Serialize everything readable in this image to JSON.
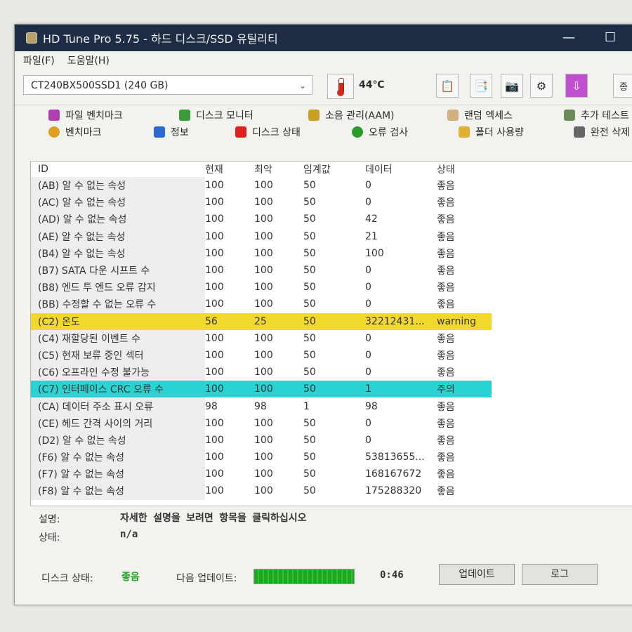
{
  "window": {
    "title": "HD Tune Pro 5.75 - 하드 디스크/SSD 유틸리티",
    "minimize": "—",
    "maximize": "☐"
  },
  "menu": [
    "파일(F)",
    "도움말(H)"
  ],
  "drive": {
    "name": "CT240BX500SSD1 (240 GB)",
    "temperature": "44℃"
  },
  "toolbar": {
    "partial_label": "종"
  },
  "tabs_row1": [
    {
      "label": "파일 벤치마크",
      "icon": "file-benchmark-icon",
      "color": "#b33fb3"
    },
    {
      "label": "디스크 모니터",
      "icon": "disk-monitor-icon",
      "color": "#3a9a3a"
    },
    {
      "label": "소음 관리(AAM)",
      "icon": "speaker-icon",
      "color": "#c8a024"
    },
    {
      "label": "랜덤 엑세스",
      "icon": "random-access-icon",
      "color": "#d0b080"
    },
    {
      "label": "추가 테스트",
      "icon": "extra-tests-icon",
      "color": "#6a8a5a"
    }
  ],
  "tabs_row2": [
    {
      "label": "벤치마크",
      "icon": "benchmark-icon",
      "color": "#e0a020"
    },
    {
      "label": "정보",
      "icon": "info-icon",
      "color": "#2a6ad0"
    },
    {
      "label": "디스크 상태",
      "icon": "health-cross-icon",
      "color": "#e02020"
    },
    {
      "label": "오류 검사",
      "icon": "magnifier-icon",
      "color": "#2a9a2a"
    },
    {
      "label": "폴더 사용량",
      "icon": "folder-icon",
      "color": "#e0b030"
    },
    {
      "label": "완전 삭제",
      "icon": "trash-icon",
      "color": "#666666"
    }
  ],
  "table": {
    "headers": [
      "ID",
      "현재",
      "최악",
      "임계값",
      "데이터",
      "상태"
    ],
    "rows": [
      [
        "(AB) 알 수 없는 속성",
        "100",
        "100",
        "50",
        "0",
        "좋음"
      ],
      [
        "(AC) 알 수 없는 속성",
        "100",
        "100",
        "50",
        "0",
        "좋음"
      ],
      [
        "(AD) 알 수 없는 속성",
        "100",
        "100",
        "50",
        "42",
        "좋음"
      ],
      [
        "(AE) 알 수 없는 속성",
        "100",
        "100",
        "50",
        "21",
        "좋음"
      ],
      [
        "(B4) 알 수 없는 속성",
        "100",
        "100",
        "50",
        "100",
        "좋음"
      ],
      [
        "(B7) SATA 다운 시프트 수",
        "100",
        "100",
        "50",
        "0",
        "좋음"
      ],
      [
        "(B8) 엔드 투 엔드 오류 감지",
        "100",
        "100",
        "50",
        "0",
        "좋음"
      ],
      [
        "(BB) 수정할 수 없는 오류 수",
        "100",
        "100",
        "50",
        "0",
        "좋음"
      ],
      [
        "(C2) 온도",
        "56",
        "25",
        "50",
        "32212431...",
        "warning"
      ],
      [
        "(C4) 재할당된 이벤트 수",
        "100",
        "100",
        "50",
        "0",
        "좋음"
      ],
      [
        "(C5) 현재 보류 중인 섹터",
        "100",
        "100",
        "50",
        "0",
        "좋음"
      ],
      [
        "(C6) 오프라인 수정 불가능",
        "100",
        "100",
        "50",
        "0",
        "좋음"
      ],
      [
        "(C7) 인터페이스 CRC 오류 수",
        "100",
        "100",
        "50",
        "1",
        "주의"
      ],
      [
        "(CA) 데이터 주소 표시 오류",
        "98",
        "98",
        "1",
        "98",
        "좋음"
      ],
      [
        "(CE) 헤드 간격 사이의 거리",
        "100",
        "100",
        "50",
        "0",
        "좋음"
      ],
      [
        "(D2) 알 수 없는 속성",
        "100",
        "100",
        "50",
        "0",
        "좋음"
      ],
      [
        "(F6) 알 수 없는 속성",
        "100",
        "100",
        "50",
        "53813655...",
        "좋음"
      ],
      [
        "(F7) 알 수 없는 속성",
        "100",
        "100",
        "50",
        "168167672",
        "좋음"
      ],
      [
        "(F8) 알 수 없는 속성",
        "100",
        "100",
        "50",
        "175288320",
        "좋음"
      ]
    ],
    "highlight_colors": {
      "warning": "#f2d82a",
      "caution": "#29d3d2"
    }
  },
  "details": {
    "desc_label": "설명:",
    "desc_value": "자세한 설명을 보려면 항목을 클릭하십시오",
    "status_label": "상태:",
    "status_value": "n/a"
  },
  "footer": {
    "disk_status_label": "디스크 상태:",
    "disk_status_value": "좋음",
    "next_update_label": "다음 업데이트:",
    "next_update_time": "0:46",
    "update_button": "업데이트",
    "log_button": "로그",
    "progress_fraction": 1.0
  }
}
